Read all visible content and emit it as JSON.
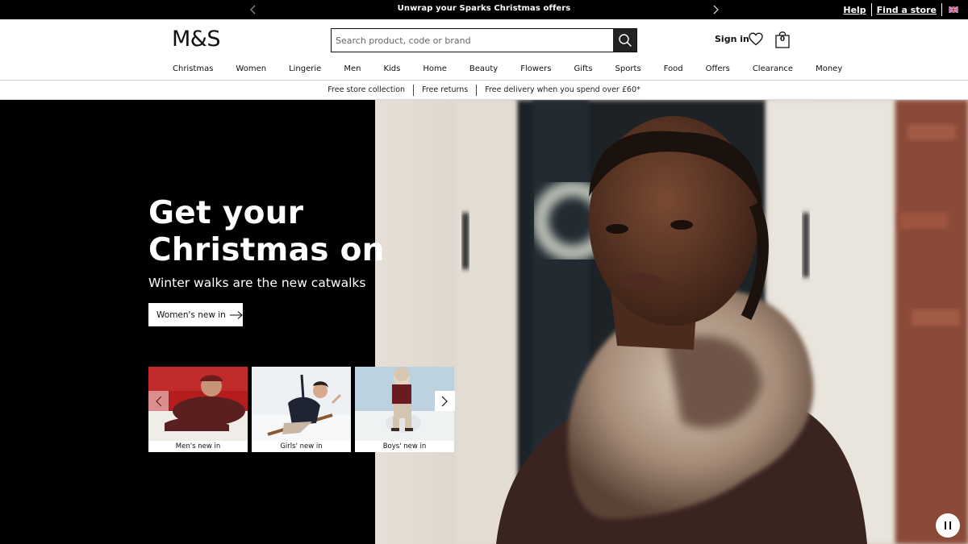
{
  "promo": {
    "text": "Unwrap your Sparks Christmas offers",
    "links": [
      "Help",
      "Find a store"
    ]
  },
  "header": {
    "logo": "M&S",
    "search_placeholder": "Search product, code or brand",
    "signin": "Sign in",
    "bag_count": "0"
  },
  "nav": [
    "Christmas",
    "Women",
    "Lingerie",
    "Men",
    "Kids",
    "Home",
    "Beauty",
    "Flowers",
    "Gifts",
    "Sports",
    "Food",
    "Offers",
    "Clearance",
    "Money"
  ],
  "usp": [
    "Free store collection",
    "Free returns",
    "Free delivery when you spend over £60*"
  ],
  "hero": {
    "title_line1": "Get your",
    "title_line2": "Christmas on",
    "subtitle": "Winter walks are the new catwalks",
    "cta": "Women's new in"
  },
  "cards": [
    "Men's new in",
    "Girls' new in",
    "Boys' new in"
  ],
  "colors": {
    "black": "#000000",
    "white": "#ffffff"
  }
}
